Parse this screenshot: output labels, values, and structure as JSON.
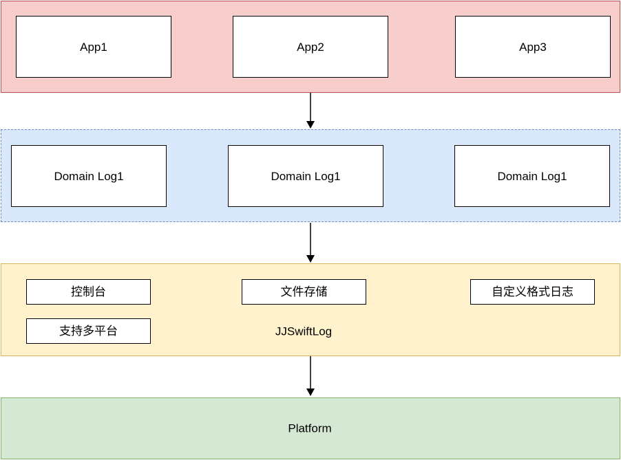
{
  "colors": {
    "apps_layer_fill": "#f8cecc",
    "apps_layer_border": "#b85450",
    "domain_layer_fill": "#dae8fc",
    "domain_layer_border": "#6c8ebf",
    "framework_layer_fill": "#fff2cc",
    "framework_layer_border": "#d6b656",
    "platform_layer_fill": "#d5e8d4",
    "platform_layer_border": "#82b366",
    "box_border": "#000000",
    "arrow": "#000000"
  },
  "apps_layer": {
    "apps": [
      "App1",
      "App2",
      "App3"
    ]
  },
  "domain_layer": {
    "logs": [
      "Domain Log1",
      "Domain Log1",
      "Domain Log1"
    ]
  },
  "framework_layer": {
    "name": "JJSwiftLog",
    "features": [
      "控制台",
      "文件存储",
      "自定义格式日志",
      "支持多平台"
    ]
  },
  "platform_layer": {
    "name": "Platform"
  }
}
